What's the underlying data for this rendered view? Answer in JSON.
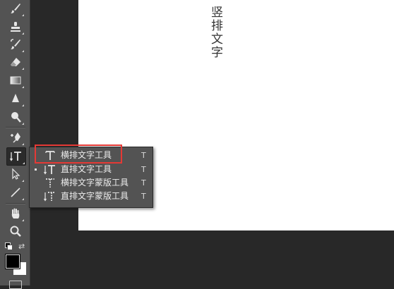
{
  "canvas": {
    "vertical_text": "竖排文字"
  },
  "flyout": {
    "items": [
      {
        "label": "横排文字工具",
        "shortcut": "T",
        "icon": "horizontal-type-icon",
        "active": false,
        "highlighted": true
      },
      {
        "label": "直排文字工具",
        "shortcut": "T",
        "icon": "vertical-type-icon",
        "active": true
      },
      {
        "label": "横排文字蒙版工具",
        "shortcut": "T",
        "icon": "horizontal-type-mask-icon",
        "active": false
      },
      {
        "label": "直排文字蒙版工具",
        "shortcut": "T",
        "icon": "vertical-type-mask-icon",
        "active": false
      }
    ]
  },
  "toolbar": {
    "tools": [
      "brush-icon",
      "clone-stamp-icon",
      "history-brush-icon",
      "eraser-icon",
      "gradient-icon",
      "blur-icon",
      "dodge-icon",
      "pen-icon",
      "vertical-type-icon",
      "path-selection-icon",
      "line-icon",
      "hand-icon",
      "zoom-icon"
    ],
    "foreground_color": "#000000",
    "background_color": "#ffffff"
  },
  "colors": {
    "highlight": "#e53935",
    "panel": "#535353",
    "workspace": "#282828"
  }
}
